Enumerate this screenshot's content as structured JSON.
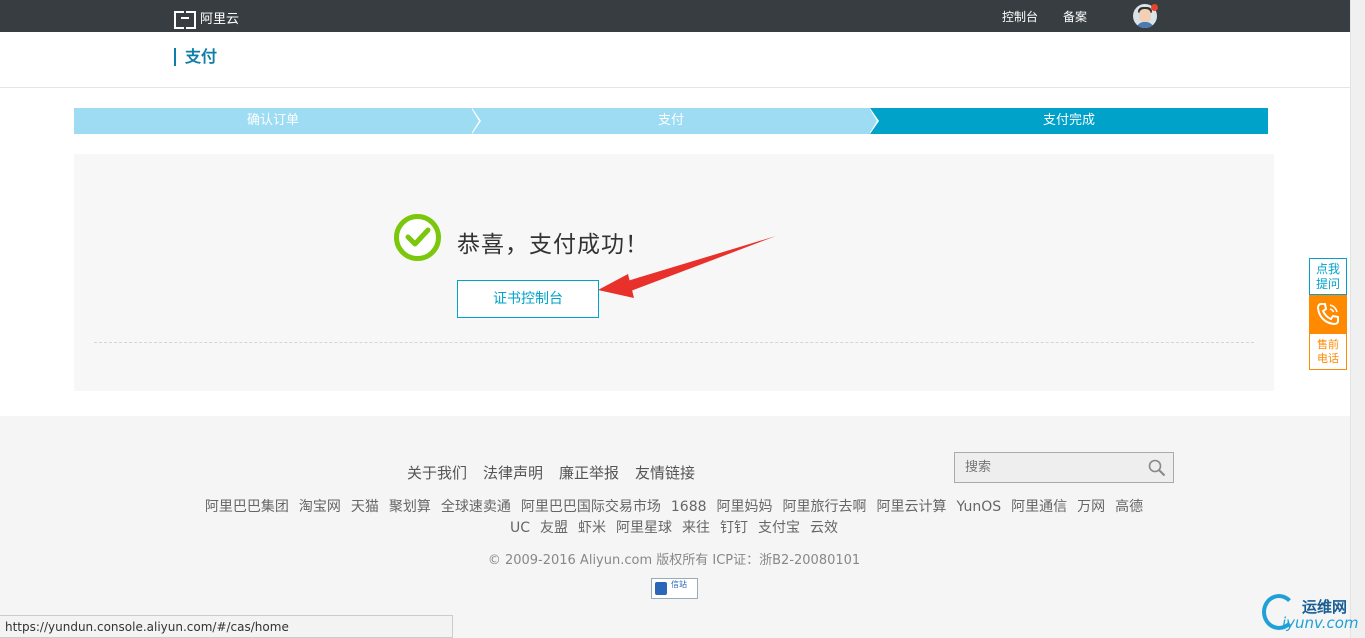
{
  "topbar": {
    "brand": "阿里云",
    "nav": [
      "控制台",
      "备案"
    ]
  },
  "page": {
    "title": "支付"
  },
  "steps": [
    "确认订单",
    "支付",
    "支付完成"
  ],
  "result": {
    "message": "恭喜，支付成功！",
    "button_label": "证书控制台"
  },
  "float_sidebar": {
    "ask_line1": "点我",
    "ask_line2": "提问",
    "pre_line1": "售前",
    "pre_line2": "电话"
  },
  "footer": {
    "links": [
      "关于我们",
      "法律声明",
      "廉正举报",
      "友情链接"
    ],
    "search_placeholder": "搜索",
    "partners": [
      "阿里巴巴集团",
      "淘宝网",
      "天猫",
      "聚划算",
      "全球速卖通",
      "阿里巴巴国际交易市场",
      "1688",
      "阿里妈妈",
      "阿里旅行去啊",
      "阿里云计算",
      "YunOS",
      "阿里通信",
      "万网",
      "高德",
      "UC",
      "友盟",
      "虾米",
      "阿里星球",
      "来往",
      "钉钉",
      "支付宝",
      "云效"
    ],
    "copyright": "© 2009-2016 Aliyun.com 版权所有 ICP证：浙B2-20080101",
    "badge_text": "信站"
  },
  "statusbar": {
    "url": "https://yundun.console.aliyun.com/#/cas/home"
  },
  "watermark": {
    "name": "运维网",
    "site": "iyunv.com"
  },
  "colors": {
    "accent": "#00a2ca",
    "step_inactive": "#9ddcf3",
    "success": "#7ac70c",
    "phone": "#ff8a00",
    "arrow": "#e8312a"
  }
}
